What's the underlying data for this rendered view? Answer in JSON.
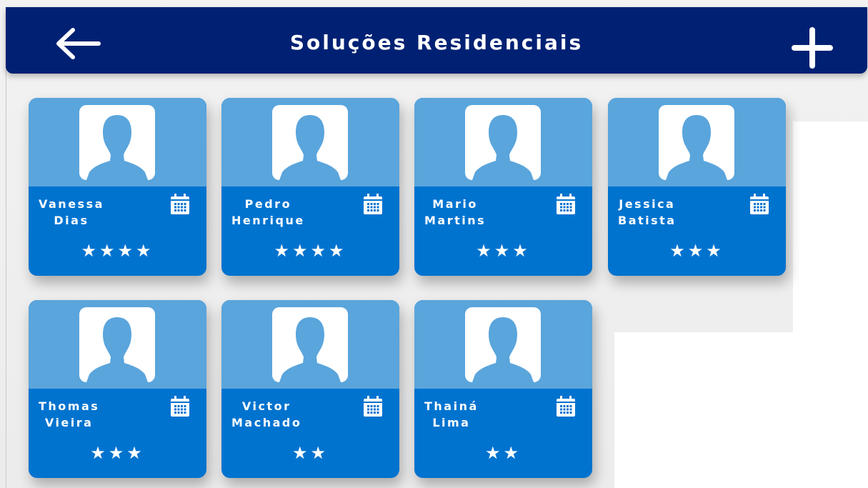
{
  "header": {
    "title": "Soluções Residenciais",
    "back_icon": "arrow-left-icon",
    "add_icon": "plus-icon",
    "color": "#002173"
  },
  "colors": {
    "card_top": "#5aa5dc",
    "card_bottom": "#0073cf",
    "text": "#ffffff"
  },
  "contacts": [
    {
      "first": "Vanessa",
      "last": "Dias",
      "stars": "★★★★",
      "rating": 4
    },
    {
      "first": "Pedro",
      "last": "Henrique",
      "stars": "★★★★",
      "rating": 4
    },
    {
      "first": "Mario",
      "last": "Martins",
      "stars": "★★★",
      "rating": 3
    },
    {
      "first": "Jessica",
      "last": "Batista",
      "stars": "★★★",
      "rating": 3
    },
    {
      "first": "Thomas",
      "last": "Vieira",
      "stars": "★★★",
      "rating": 3
    },
    {
      "first": "Victor",
      "last": "Machado",
      "stars": "★★",
      "rating": 2
    },
    {
      "first": "Thainá",
      "last": "Lima",
      "stars": "★★",
      "rating": 2
    }
  ]
}
